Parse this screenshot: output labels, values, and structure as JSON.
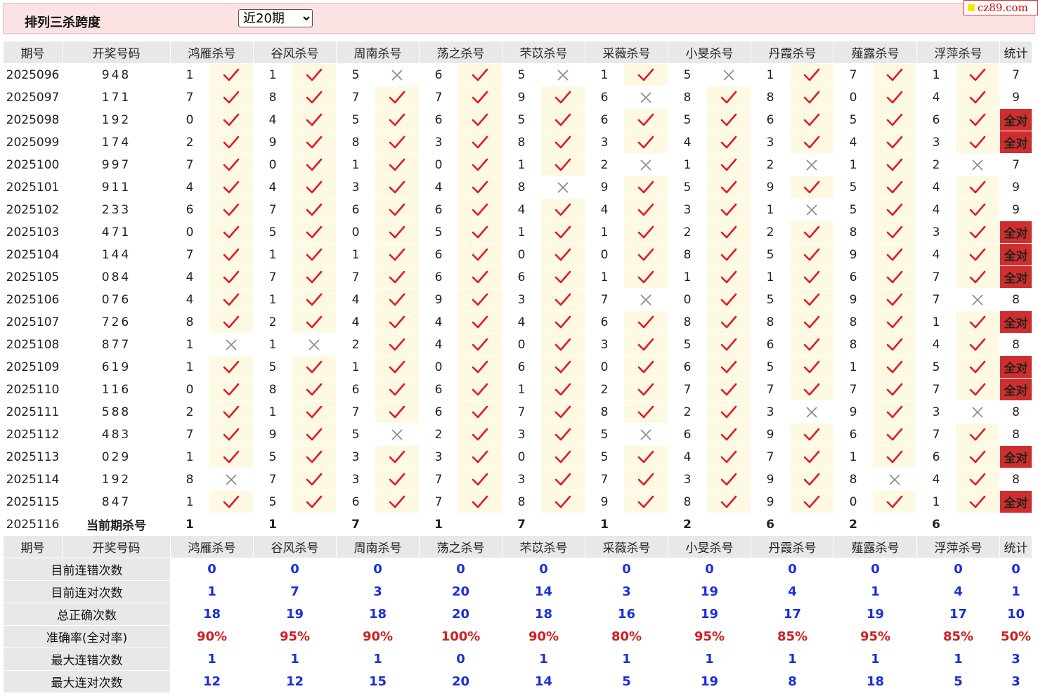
{
  "header": {
    "title": "排列三杀跨度",
    "period_select": "近20期",
    "logo": "cz89.com"
  },
  "columns": {
    "issue": "期号",
    "draw": "开奖号码",
    "experts": [
      "鸿雁杀号",
      "谷风杀号",
      "周南杀号",
      "荡之杀号",
      "芣苡杀号",
      "采薇杀号",
      "小旻杀号",
      "丹霞杀号",
      "薤露杀号",
      "浮萍杀号"
    ],
    "stat": "统计"
  },
  "all_correct_label": "全对",
  "rows": [
    {
      "issue": "2025096",
      "draw": "948",
      "kills": [
        [
          "1",
          1
        ],
        [
          "1",
          1
        ],
        [
          "5",
          0
        ],
        [
          "6",
          1
        ],
        [
          "5",
          0
        ],
        [
          "1",
          1
        ],
        [
          "5",
          0
        ],
        [
          "1",
          1
        ],
        [
          "7",
          1
        ],
        [
          "1",
          1
        ]
      ],
      "stat": "7"
    },
    {
      "issue": "2025097",
      "draw": "171",
      "kills": [
        [
          "7",
          1
        ],
        [
          "8",
          1
        ],
        [
          "7",
          1
        ],
        [
          "7",
          1
        ],
        [
          "9",
          1
        ],
        [
          "6",
          0
        ],
        [
          "8",
          1
        ],
        [
          "8",
          1
        ],
        [
          "0",
          1
        ],
        [
          "4",
          1
        ]
      ],
      "stat": "9"
    },
    {
      "issue": "2025098",
      "draw": "192",
      "kills": [
        [
          "0",
          1
        ],
        [
          "4",
          1
        ],
        [
          "5",
          1
        ],
        [
          "6",
          1
        ],
        [
          "5",
          1
        ],
        [
          "6",
          1
        ],
        [
          "5",
          1
        ],
        [
          "6",
          1
        ],
        [
          "5",
          1
        ],
        [
          "6",
          1
        ]
      ],
      "stat": "全对"
    },
    {
      "issue": "2025099",
      "draw": "174",
      "kills": [
        [
          "2",
          1
        ],
        [
          "9",
          1
        ],
        [
          "8",
          1
        ],
        [
          "3",
          1
        ],
        [
          "8",
          1
        ],
        [
          "3",
          1
        ],
        [
          "4",
          1
        ],
        [
          "3",
          1
        ],
        [
          "4",
          1
        ],
        [
          "3",
          1
        ]
      ],
      "stat": "全对"
    },
    {
      "issue": "2025100",
      "draw": "997",
      "kills": [
        [
          "7",
          1
        ],
        [
          "0",
          1
        ],
        [
          "1",
          1
        ],
        [
          "0",
          1
        ],
        [
          "1",
          1
        ],
        [
          "2",
          0
        ],
        [
          "1",
          1
        ],
        [
          "2",
          0
        ],
        [
          "1",
          1
        ],
        [
          "2",
          0
        ]
      ],
      "stat": "7"
    },
    {
      "issue": "2025101",
      "draw": "911",
      "kills": [
        [
          "4",
          1
        ],
        [
          "4",
          1
        ],
        [
          "3",
          1
        ],
        [
          "4",
          1
        ],
        [
          "8",
          0
        ],
        [
          "9",
          1
        ],
        [
          "5",
          1
        ],
        [
          "9",
          1
        ],
        [
          "5",
          1
        ],
        [
          "4",
          1
        ]
      ],
      "stat": "9"
    },
    {
      "issue": "2025102",
      "draw": "233",
      "kills": [
        [
          "6",
          1
        ],
        [
          "7",
          1
        ],
        [
          "6",
          1
        ],
        [
          "6",
          1
        ],
        [
          "4",
          1
        ],
        [
          "4",
          1
        ],
        [
          "3",
          1
        ],
        [
          "1",
          0
        ],
        [
          "5",
          1
        ],
        [
          "4",
          1
        ]
      ],
      "stat": "9"
    },
    {
      "issue": "2025103",
      "draw": "471",
      "kills": [
        [
          "0",
          1
        ],
        [
          "5",
          1
        ],
        [
          "0",
          1
        ],
        [
          "5",
          1
        ],
        [
          "1",
          1
        ],
        [
          "1",
          1
        ],
        [
          "2",
          1
        ],
        [
          "2",
          1
        ],
        [
          "8",
          1
        ],
        [
          "3",
          1
        ]
      ],
      "stat": "全对"
    },
    {
      "issue": "2025104",
      "draw": "144",
      "kills": [
        [
          "7",
          1
        ],
        [
          "1",
          1
        ],
        [
          "1",
          1
        ],
        [
          "6",
          1
        ],
        [
          "0",
          1
        ],
        [
          "0",
          1
        ],
        [
          "8",
          1
        ],
        [
          "5",
          1
        ],
        [
          "9",
          1
        ],
        [
          "4",
          1
        ]
      ],
      "stat": "全对"
    },
    {
      "issue": "2025105",
      "draw": "084",
      "kills": [
        [
          "4",
          1
        ],
        [
          "7",
          1
        ],
        [
          "7",
          1
        ],
        [
          "6",
          1
        ],
        [
          "6",
          1
        ],
        [
          "1",
          1
        ],
        [
          "1",
          1
        ],
        [
          "1",
          1
        ],
        [
          "6",
          1
        ],
        [
          "7",
          1
        ]
      ],
      "stat": "全对"
    },
    {
      "issue": "2025106",
      "draw": "076",
      "kills": [
        [
          "4",
          1
        ],
        [
          "1",
          1
        ],
        [
          "4",
          1
        ],
        [
          "9",
          1
        ],
        [
          "3",
          1
        ],
        [
          "7",
          0
        ],
        [
          "0",
          1
        ],
        [
          "5",
          1
        ],
        [
          "9",
          1
        ],
        [
          "7",
          0
        ]
      ],
      "stat": "8"
    },
    {
      "issue": "2025107",
      "draw": "726",
      "kills": [
        [
          "8",
          1
        ],
        [
          "2",
          1
        ],
        [
          "4",
          1
        ],
        [
          "4",
          1
        ],
        [
          "4",
          1
        ],
        [
          "6",
          1
        ],
        [
          "8",
          1
        ],
        [
          "8",
          1
        ],
        [
          "8",
          1
        ],
        [
          "1",
          1
        ]
      ],
      "stat": "全对"
    },
    {
      "issue": "2025108",
      "draw": "877",
      "kills": [
        [
          "1",
          0
        ],
        [
          "1",
          0
        ],
        [
          "2",
          1
        ],
        [
          "4",
          1
        ],
        [
          "0",
          1
        ],
        [
          "3",
          1
        ],
        [
          "5",
          1
        ],
        [
          "6",
          1
        ],
        [
          "8",
          1
        ],
        [
          "4",
          1
        ]
      ],
      "stat": "8"
    },
    {
      "issue": "2025109",
      "draw": "619",
      "kills": [
        [
          "1",
          1
        ],
        [
          "5",
          1
        ],
        [
          "1",
          1
        ],
        [
          "0",
          1
        ],
        [
          "6",
          1
        ],
        [
          "0",
          1
        ],
        [
          "6",
          1
        ],
        [
          "5",
          1
        ],
        [
          "1",
          1
        ],
        [
          "5",
          1
        ]
      ],
      "stat": "全对"
    },
    {
      "issue": "2025110",
      "draw": "116",
      "kills": [
        [
          "0",
          1
        ],
        [
          "8",
          1
        ],
        [
          "6",
          1
        ],
        [
          "6",
          1
        ],
        [
          "1",
          1
        ],
        [
          "2",
          1
        ],
        [
          "7",
          1
        ],
        [
          "7",
          1
        ],
        [
          "7",
          1
        ],
        [
          "7",
          1
        ]
      ],
      "stat": "全对"
    },
    {
      "issue": "2025111",
      "draw": "588",
      "kills": [
        [
          "2",
          1
        ],
        [
          "1",
          1
        ],
        [
          "7",
          1
        ],
        [
          "6",
          1
        ],
        [
          "7",
          1
        ],
        [
          "8",
          1
        ],
        [
          "2",
          1
        ],
        [
          "3",
          0
        ],
        [
          "9",
          1
        ],
        [
          "3",
          0
        ]
      ],
      "stat": "8"
    },
    {
      "issue": "2025112",
      "draw": "483",
      "kills": [
        [
          "7",
          1
        ],
        [
          "9",
          1
        ],
        [
          "5",
          0
        ],
        [
          "2",
          1
        ],
        [
          "3",
          1
        ],
        [
          "5",
          0
        ],
        [
          "6",
          1
        ],
        [
          "9",
          1
        ],
        [
          "6",
          1
        ],
        [
          "7",
          1
        ]
      ],
      "stat": "8"
    },
    {
      "issue": "2025113",
      "draw": "029",
      "kills": [
        [
          "1",
          1
        ],
        [
          "5",
          1
        ],
        [
          "3",
          1
        ],
        [
          "3",
          1
        ],
        [
          "0",
          1
        ],
        [
          "5",
          1
        ],
        [
          "4",
          1
        ],
        [
          "7",
          1
        ],
        [
          "1",
          1
        ],
        [
          "6",
          1
        ]
      ],
      "stat": "全对"
    },
    {
      "issue": "2025114",
      "draw": "192",
      "kills": [
        [
          "8",
          0
        ],
        [
          "7",
          1
        ],
        [
          "3",
          1
        ],
        [
          "7",
          1
        ],
        [
          "3",
          1
        ],
        [
          "7",
          1
        ],
        [
          "3",
          1
        ],
        [
          "9",
          1
        ],
        [
          "8",
          0
        ],
        [
          "4",
          1
        ]
      ],
      "stat": "8"
    },
    {
      "issue": "2025115",
      "draw": "847",
      "kills": [
        [
          "1",
          1
        ],
        [
          "5",
          1
        ],
        [
          "6",
          1
        ],
        [
          "7",
          1
        ],
        [
          "8",
          1
        ],
        [
          "9",
          1
        ],
        [
          "8",
          1
        ],
        [
          "9",
          1
        ],
        [
          "0",
          1
        ],
        [
          "1",
          1
        ]
      ],
      "stat": "全对"
    }
  ],
  "prediction": {
    "issue": "2025116",
    "label": "当前期杀号",
    "values": [
      "1",
      "1",
      "7",
      "1",
      "7",
      "1",
      "2",
      "6",
      "2",
      "6"
    ]
  },
  "stats": [
    {
      "label": "目前连错次数",
      "values": [
        "0",
        "0",
        "0",
        "0",
        "0",
        "0",
        "0",
        "0",
        "0",
        "0"
      ],
      "total": "0"
    },
    {
      "label": "目前连对次数",
      "values": [
        "1",
        "7",
        "3",
        "20",
        "14",
        "3",
        "19",
        "4",
        "1",
        "4"
      ],
      "total": "1"
    },
    {
      "label": "总正确次数",
      "values": [
        "18",
        "19",
        "18",
        "20",
        "18",
        "16",
        "19",
        "17",
        "19",
        "17"
      ],
      "total": "10"
    },
    {
      "label": "准确率(全对率)",
      "values": [
        "90%",
        "95%",
        "90%",
        "100%",
        "90%",
        "80%",
        "95%",
        "85%",
        "95%",
        "85%"
      ],
      "total": "50%",
      "pct": true
    },
    {
      "label": "最大连错次数",
      "values": [
        "1",
        "1",
        "1",
        "0",
        "1",
        "1",
        "1",
        "1",
        "1",
        "1"
      ],
      "total": "3"
    },
    {
      "label": "最大连对次数",
      "values": [
        "12",
        "12",
        "15",
        "20",
        "14",
        "5",
        "19",
        "8",
        "18",
        "5"
      ],
      "total": "3"
    }
  ]
}
